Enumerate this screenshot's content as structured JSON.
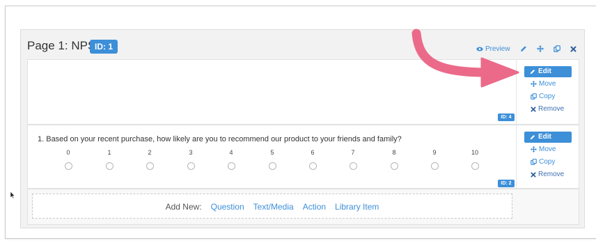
{
  "page": {
    "title": "Page 1: NPS",
    "id_badge": "ID: 1",
    "preview_label": "Preview",
    "header_icons": [
      "pencil-icon",
      "move-icon",
      "copy-icon",
      "close-icon"
    ]
  },
  "sections": [
    {
      "id_badge": "ID: 4",
      "actions": {
        "edit": "Edit",
        "move": "Move",
        "copy": "Copy",
        "remove": "Remove"
      }
    },
    {
      "id_badge": "ID: 2",
      "question": "1. Based on your recent purchase, how likely are you to recommend our product to your friends and family?",
      "scale": [
        "0",
        "1",
        "2",
        "3",
        "4",
        "5",
        "6",
        "7",
        "8",
        "9",
        "10"
      ],
      "actions": {
        "edit": "Edit",
        "move": "Move",
        "copy": "Copy",
        "remove": "Remove"
      }
    }
  ],
  "add_new": {
    "label": "Add New:",
    "links": [
      "Question",
      "Text/Media",
      "Action",
      "Library Item"
    ]
  },
  "colors": {
    "accent": "#3d8fd8",
    "arrow": "#ec6a89"
  }
}
